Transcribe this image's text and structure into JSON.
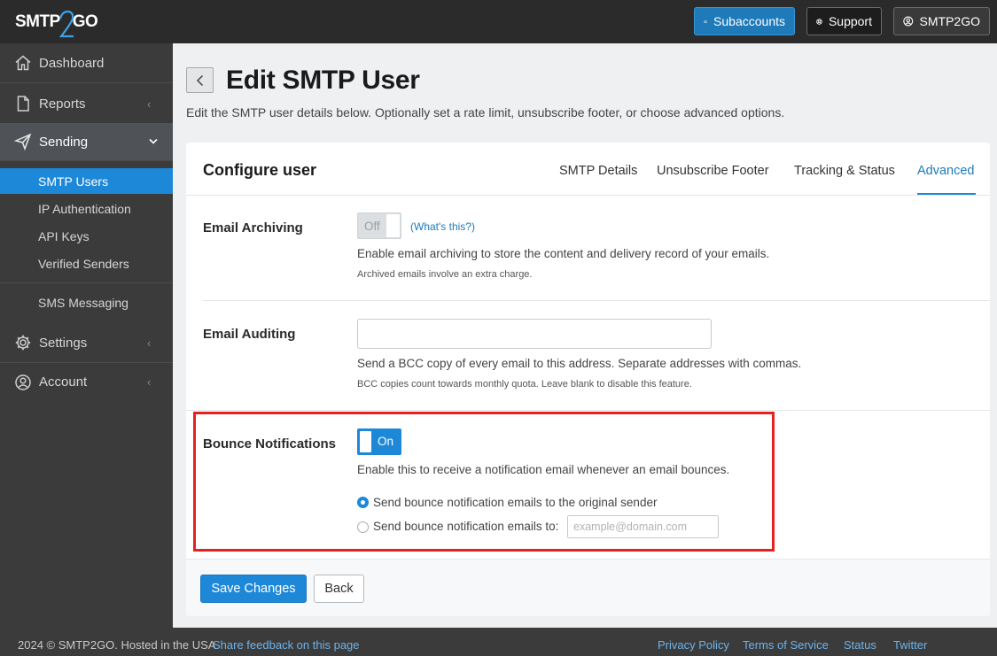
{
  "brand": {
    "logo_text_left": "SMTP",
    "logo_text_right": "GO",
    "logo_digit": "2"
  },
  "topbar": {
    "subaccounts_label": "Subaccounts",
    "support_label": "Support",
    "account_label": "SMTP2GO"
  },
  "sidebar": {
    "dashboard": "Dashboard",
    "reports": "Reports",
    "sending": "Sending",
    "sub_items": [
      "SMTP Users",
      "IP Authentication",
      "API Keys",
      "Verified Senders"
    ],
    "sms": "SMS Messaging",
    "settings": "Settings",
    "account": "Account"
  },
  "page": {
    "title": "Edit SMTP User",
    "description": "Edit the SMTP user details below. Optionally set a rate limit, unsubscribe footer, or choose advanced options."
  },
  "card": {
    "title": "Configure user",
    "tabs": [
      "SMTP Details",
      "Unsubscribe Footer",
      "Tracking & Status",
      "Advanced"
    ],
    "active_tab": "Advanced"
  },
  "archiving": {
    "label": "Email Archiving",
    "toggle_text": "Off",
    "whats_this": "(What's this?)",
    "help": "Enable email archiving to store the content and delivery record of your emails.",
    "note": "Archived emails involve an extra charge."
  },
  "auditing": {
    "label": "Email Auditing",
    "value": "",
    "help": "Send a BCC copy of every email to this address. Separate addresses with commas.",
    "note": "BCC copies count towards monthly quota. Leave blank to disable this feature."
  },
  "bounce": {
    "label": "Bounce Notifications",
    "toggle_text": "On",
    "help": "Enable this to receive a notification email whenever an email bounces.",
    "option_original": "Send bounce notification emails to the original sender",
    "option_custom": "Send bounce notification emails to:",
    "custom_placeholder": "example@domain.com",
    "selected": "original"
  },
  "actions": {
    "save": "Save Changes",
    "back": "Back"
  },
  "footer": {
    "copyright": "2024 © SMTP2GO. Hosted in the USA",
    "feedback": "Share feedback on this page",
    "privacy": "Privacy Policy",
    "terms": "Terms of Service",
    "status": "Status",
    "twitter": "Twitter"
  },
  "colors": {
    "accent": "#1e88d8",
    "highlight": "#e8201f",
    "topbar": "#2b2b2b",
    "sidebar": "#3b3b3b"
  }
}
